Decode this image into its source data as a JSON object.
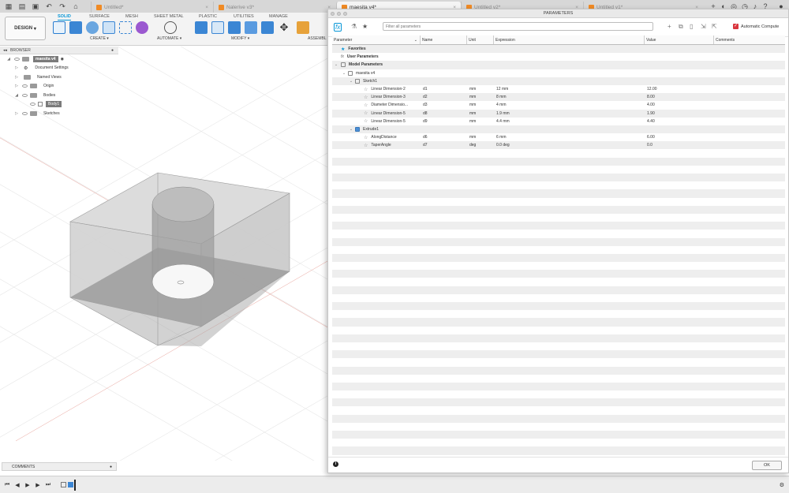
{
  "tabs": [
    {
      "label": "Untitled*",
      "active": false
    },
    {
      "label": "Nalerive v3*",
      "active": false
    },
    {
      "label": "maesita v4*",
      "active": true
    },
    {
      "label": "Untitled v2*",
      "active": false
    },
    {
      "label": "Untitled v1*",
      "active": false
    }
  ],
  "toolbar": {
    "design_label": "DESIGN",
    "workspace_tabs": [
      "SOLID",
      "SURFACE",
      "MESH",
      "SHEET METAL",
      "PLASTIC",
      "UTILITIES",
      "MANAGE"
    ],
    "active_workspace": "SOLID",
    "groups": [
      "CREATE",
      "AUTOMATE",
      "MODIFY",
      "ASSEMBL"
    ]
  },
  "browser": {
    "title": "BROWSER",
    "root": "maesita v4",
    "items": [
      {
        "label": "Document Settings"
      },
      {
        "label": "Named Views"
      },
      {
        "label": "Origin"
      },
      {
        "label": "Bodies"
      },
      {
        "label": "Body1"
      },
      {
        "label": "Sketches"
      }
    ]
  },
  "comments": {
    "label": "COMMENTS"
  },
  "parameters": {
    "title": "PARAMETERS",
    "search_placeholder": "Filter all parameters",
    "auto_compute_label": "Automatic Compute",
    "auto_compute_checked": true,
    "columns": [
      "Parameter",
      "Name",
      "Unit",
      "Expression",
      "Value",
      "Comments"
    ],
    "groups": {
      "favorites": "Favorites",
      "user": "User Parameters",
      "model": "Model Parameters",
      "component": "maesita v4",
      "sketch": "Sketch1",
      "extrude": "Extrude1"
    },
    "rows": [
      {
        "param": "Linear Dimension-2",
        "name": "d1",
        "unit": "mm",
        "expr": "12 mm",
        "value": "12.00"
      },
      {
        "param": "Linear Dimension-3",
        "name": "d2",
        "unit": "mm",
        "expr": "8 mm",
        "value": "8.00"
      },
      {
        "param": "Diameter Dimensio...",
        "name": "d3",
        "unit": "mm",
        "expr": "4 mm",
        "value": "4.00"
      },
      {
        "param": "Linear Dimension-5",
        "name": "d8",
        "unit": "mm",
        "expr": "1.9 mm",
        "value": "1.90"
      },
      {
        "param": "Linear Dimension-5",
        "name": "d9",
        "unit": "mm",
        "expr": "4.4 mm",
        "value": "4.40"
      }
    ],
    "extrude_rows": [
      {
        "param": "AlongDistance",
        "name": "d6",
        "unit": "mm",
        "expr": "6 mm",
        "value": "6.00"
      },
      {
        "param": "TaperAngle",
        "name": "d7",
        "unit": "deg",
        "expr": "0.0 deg",
        "value": "0.0"
      }
    ],
    "ok_label": "OK"
  }
}
